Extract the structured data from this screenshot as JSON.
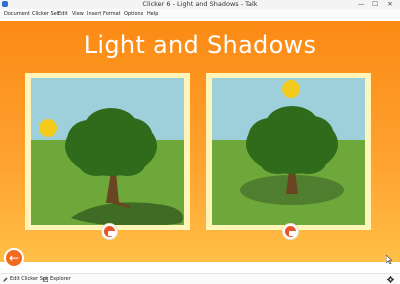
{
  "window": {
    "title": "Clicker 6 - Light and Shadows - Talk",
    "controls": {
      "minimize": "—",
      "maximize": "☐",
      "close": "✕"
    }
  },
  "menu": [
    "Document",
    "Clicker Set",
    "Edit",
    "View",
    "Insert",
    "Format",
    "Options",
    "Help"
  ],
  "page": {
    "title": "Light and Shadows"
  },
  "bottom_bar": {
    "edit_label": "Edit Clicker Set",
    "explorer_label": "Explorer"
  },
  "icons": {
    "back": "arrow-left-icon",
    "speak": "speech-bubble-icon",
    "settings": "gear-icon",
    "edit": "pencil-icon",
    "explorer": "explorer-icon"
  },
  "colors": {
    "panel": "#fb8a14",
    "frame": "#fff5b8",
    "sky": "#9ed0dc",
    "grass": "#6fa83a",
    "sun": "#f3cb1c",
    "tree": "#2f6b1a",
    "accent": "#e8542a"
  }
}
